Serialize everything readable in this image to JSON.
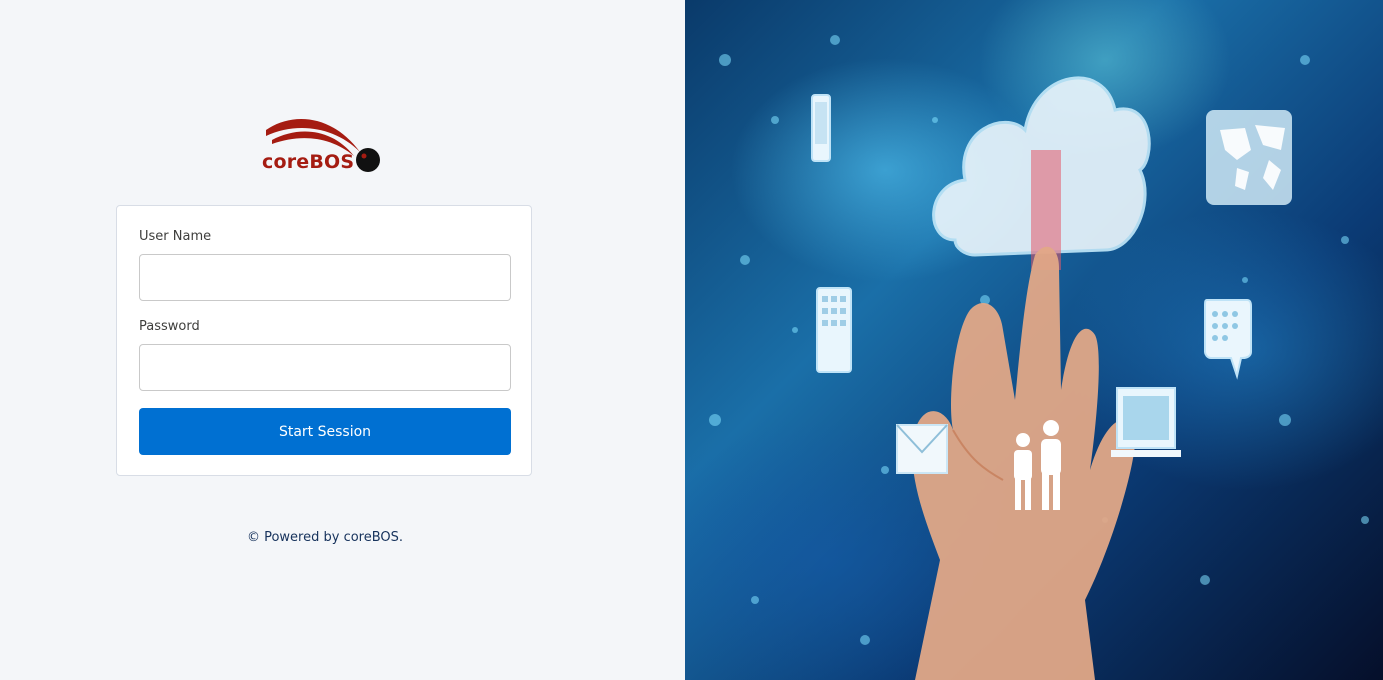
{
  "brand": {
    "logo_text": "coreBOS",
    "logo_color": "#a51c12"
  },
  "login_form": {
    "username_label": "User Name",
    "username_value": "",
    "password_label": "Password",
    "password_value": "",
    "submit_label": "Start Session",
    "submit_color": "#0070d2"
  },
  "footer": {
    "text": "© Powered by coreBOS."
  },
  "hero": {
    "icons": [
      "phone-icon",
      "tablet-icon",
      "envelope-icon",
      "cloud-icon",
      "world-map-icon",
      "chat-bubble-icon",
      "laptop-icon",
      "people-icon",
      "hand-icon"
    ]
  }
}
